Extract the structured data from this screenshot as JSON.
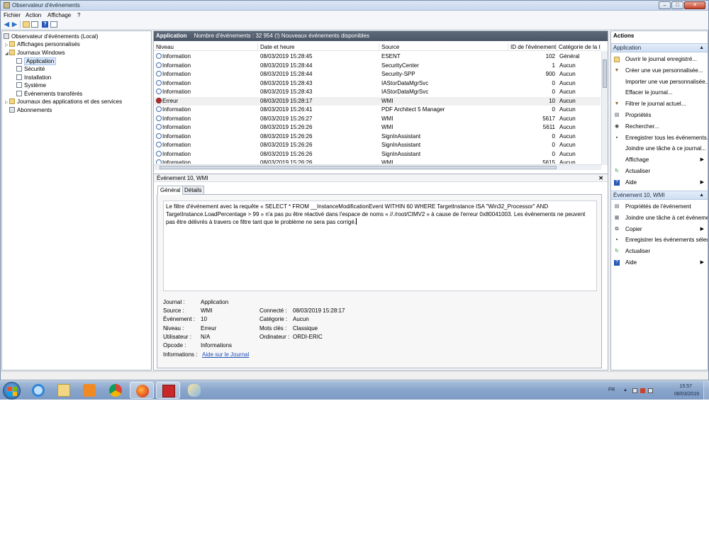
{
  "window": {
    "title": "Observateur d'événements"
  },
  "menu": {
    "file": "Fichier",
    "action": "Action",
    "view": "Affichage",
    "help": "?"
  },
  "tree": {
    "items": [
      {
        "label": "Observateur d'événements (Local)",
        "icon": "event-viewer-icon"
      },
      {
        "label": "Affichages personnalisés",
        "icon": "folder-icon"
      },
      {
        "label": "Journaux Windows",
        "icon": "folder-icon"
      },
      {
        "label": "Application",
        "icon": "log-icon"
      },
      {
        "label": "Sécurité",
        "icon": "log-icon"
      },
      {
        "label": "Installation",
        "icon": "log-icon"
      },
      {
        "label": "Système",
        "icon": "log-icon"
      },
      {
        "label": "Événements transférés",
        "icon": "log-icon"
      },
      {
        "label": "Journaux des applications et des services",
        "icon": "folder-icon"
      },
      {
        "label": "Abonnements",
        "icon": "subscriptions-icon"
      }
    ]
  },
  "list": {
    "title": "Application",
    "count_text": "Nombre d'événements : 32 954 (!) Nouveaux événements disponibles",
    "columns": [
      "Niveau",
      "Date et heure",
      "Source",
      "ID de l'événement",
      "Catégorie de la t"
    ],
    "rows": [
      {
        "level": "Information",
        "date": "08/03/2019 15:28:45",
        "source": "ESENT",
        "id": "102",
        "category": "Général"
      },
      {
        "level": "Information",
        "date": "08/03/2019 15:28:44",
        "source": "SecurityCenter",
        "id": "1",
        "category": "Aucun"
      },
      {
        "level": "Information",
        "date": "08/03/2019 15:28:44",
        "source": "Security-SPP",
        "id": "900",
        "category": "Aucun"
      },
      {
        "level": "Information",
        "date": "08/03/2019 15:28:43",
        "source": "IAStorDataMgrSvc",
        "id": "0",
        "category": "Aucun"
      },
      {
        "level": "Information",
        "date": "08/03/2019 15:28:43",
        "source": "IAStorDataMgrSvc",
        "id": "0",
        "category": "Aucun"
      },
      {
        "level": "Erreur",
        "date": "08/03/2019 15:28:17",
        "source": "WMI",
        "id": "10",
        "category": "Aucun"
      },
      {
        "level": "Information",
        "date": "08/03/2019 15:26:41",
        "source": "PDF Architect 5 Manager",
        "id": "0",
        "category": "Aucun"
      },
      {
        "level": "Information",
        "date": "08/03/2019 15:26:27",
        "source": "WMI",
        "id": "5617",
        "category": "Aucun"
      },
      {
        "level": "Information",
        "date": "08/03/2019 15:26:26",
        "source": "WMI",
        "id": "5611",
        "category": "Aucun"
      },
      {
        "level": "Information",
        "date": "08/03/2019 15:26:26",
        "source": "SignInAssistant",
        "id": "0",
        "category": "Aucun"
      },
      {
        "level": "Information",
        "date": "08/03/2019 15:26:26",
        "source": "SignInAssistant",
        "id": "0",
        "category": "Aucun"
      },
      {
        "level": "Information",
        "date": "08/03/2019 15:26:26",
        "source": "SignInAssistant",
        "id": "0",
        "category": "Aucun"
      },
      {
        "level": "Information",
        "date": "08/03/2019 15:26:26",
        "source": "WMI",
        "id": "5615",
        "category": "Aucun"
      }
    ]
  },
  "detail": {
    "title": "Événement 10, WMI",
    "tabs": [
      "Général",
      "Détails"
    ],
    "message": "Le filtre d'événement avec la requête « SELECT * FROM __InstanceModificationEvent WITHIN 60 WHERE TargetInstance ISA \"Win32_Processor\" AND TargetInstance.LoadPercentage > 99 » n'a pas pu être réactivé dans l'espace de noms « //./root/CIMV2 » à cause de l'erreur 0x80041003. Les événements ne peuvent pas être délivrés à travers ce filtre tant que le problème ne sera pas corrigé.",
    "props": {
      "journal_label": "Journal :",
      "journal": "Application",
      "source_label": "Source :",
      "source": "WMI",
      "logged_label": "Connecté :",
      "logged": "08/03/2019 15:28:17",
      "event_label": "Événement :",
      "event": "10",
      "category_label": "Catégorie :",
      "category": "Aucun",
      "level_label": "Niveau :",
      "level": "Erreur",
      "keywords_label": "Mots clés :",
      "keywords": "Classique",
      "user_label": "Utilisateur :",
      "user": "N/A",
      "computer_label": "Ordinateur :",
      "computer": "ORDI-ERIC",
      "opcode_label": "Opcode :",
      "opcode": "Informations",
      "info_label": "Informations :",
      "info_link": "Aide sur le Journal"
    }
  },
  "actions": {
    "title": "Actions",
    "section1": "Application",
    "items1": [
      {
        "label": "Ouvrir le journal enregistré...",
        "icon": "open-folder-icon"
      },
      {
        "label": "Créer une vue personnalisée...",
        "icon": "filter-icon"
      },
      {
        "label": "Importer une vue personnalisée...",
        "icon": ""
      },
      {
        "label": "Effacer le journal...",
        "icon": ""
      },
      {
        "label": "Filtrer le journal actuel...",
        "icon": "filter-icon"
      },
      {
        "label": "Propriétés",
        "icon": "properties-icon"
      },
      {
        "label": "Rechercher...",
        "icon": "binoculars-icon"
      },
      {
        "label": "Enregistrer tous les événements...",
        "icon": "save-icon"
      },
      {
        "label": "Joindre une tâche à ce journal...",
        "icon": ""
      },
      {
        "label": "Affichage",
        "icon": "",
        "submenu": "▶"
      },
      {
        "label": "Actualiser",
        "icon": "refresh-icon"
      },
      {
        "label": "Aide",
        "icon": "help-icon",
        "submenu": "▶"
      }
    ],
    "section2": "Événement 10, WMI",
    "items2": [
      {
        "label": "Propriétés de l'événement",
        "icon": "properties-icon"
      },
      {
        "label": "Joindre une tâche à cet événement...",
        "icon": "task-icon"
      },
      {
        "label": "Copier",
        "icon": "copy-icon",
        "submenu": "▶"
      },
      {
        "label": "Enregistrer les événements sélectionnés...",
        "icon": "save-icon"
      },
      {
        "label": "Actualiser",
        "icon": "refresh-icon"
      },
      {
        "label": "Aide",
        "icon": "help-icon",
        "submenu": "▶"
      }
    ]
  },
  "taskbar": {
    "lang": "FR",
    "time": "15:57",
    "date": "08/03/2019"
  },
  "colors": {
    "header_bar": "#4a5565",
    "section_blue": "#cfdff3",
    "error_red": "#b42b2b",
    "info_blue": "#3c6bb2",
    "taskbar": "#8aa6cc"
  }
}
